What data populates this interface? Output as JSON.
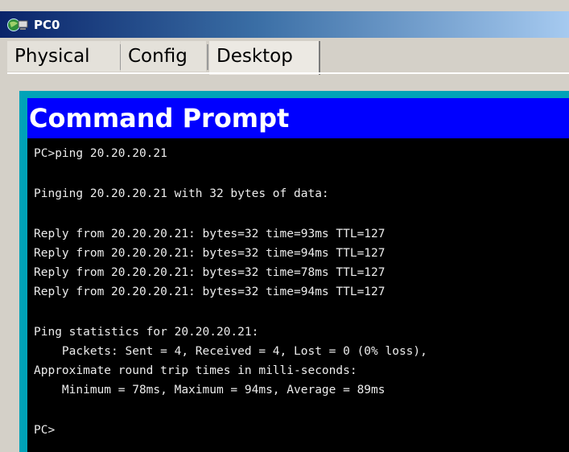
{
  "window": {
    "title": "PC0",
    "icon": "pc-globe-icon"
  },
  "tabs": [
    {
      "label": "Physical",
      "selected": false
    },
    {
      "label": "Config",
      "selected": false
    },
    {
      "label": "Desktop",
      "selected": true
    }
  ],
  "command_prompt": {
    "title": "Command Prompt",
    "lines": [
      "PC>ping 20.20.20.21",
      "",
      "Pinging 20.20.20.21 with 32 bytes of data:",
      "",
      "Reply from 20.20.20.21: bytes=32 time=93ms TTL=127",
      "Reply from 20.20.20.21: bytes=32 time=94ms TTL=127",
      "Reply from 20.20.20.21: bytes=32 time=78ms TTL=127",
      "Reply from 20.20.20.21: bytes=32 time=94ms TTL=127",
      "",
      "Ping statistics for 20.20.20.21:",
      "    Packets: Sent = 4, Received = 4, Lost = 0 (0% loss),",
      "Approximate round trip times in milli-seconds:",
      "    Minimum = 78ms, Maximum = 94ms, Average = 89ms",
      "",
      "PC>"
    ]
  },
  "colors": {
    "header_blue": "#0000ff",
    "panel_teal": "#00a3b8",
    "console_bg": "#000000",
    "console_text": "#ececec"
  }
}
